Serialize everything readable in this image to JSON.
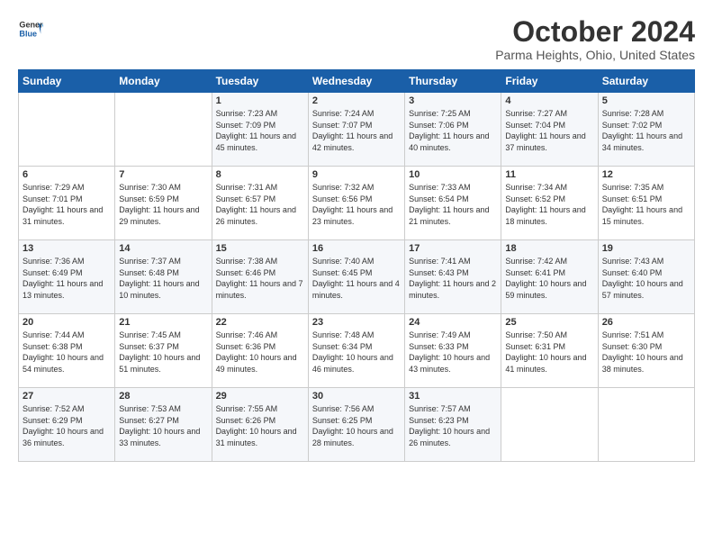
{
  "header": {
    "logo_line1": "General",
    "logo_line2": "Blue",
    "month": "October 2024",
    "location": "Parma Heights, Ohio, United States"
  },
  "days_of_week": [
    "Sunday",
    "Monday",
    "Tuesday",
    "Wednesday",
    "Thursday",
    "Friday",
    "Saturday"
  ],
  "weeks": [
    [
      {
        "day": "",
        "info": ""
      },
      {
        "day": "",
        "info": ""
      },
      {
        "day": "1",
        "info": "Sunrise: 7:23 AM\nSunset: 7:09 PM\nDaylight: 11 hours and 45 minutes."
      },
      {
        "day": "2",
        "info": "Sunrise: 7:24 AM\nSunset: 7:07 PM\nDaylight: 11 hours and 42 minutes."
      },
      {
        "day": "3",
        "info": "Sunrise: 7:25 AM\nSunset: 7:06 PM\nDaylight: 11 hours and 40 minutes."
      },
      {
        "day": "4",
        "info": "Sunrise: 7:27 AM\nSunset: 7:04 PM\nDaylight: 11 hours and 37 minutes."
      },
      {
        "day": "5",
        "info": "Sunrise: 7:28 AM\nSunset: 7:02 PM\nDaylight: 11 hours and 34 minutes."
      }
    ],
    [
      {
        "day": "6",
        "info": "Sunrise: 7:29 AM\nSunset: 7:01 PM\nDaylight: 11 hours and 31 minutes."
      },
      {
        "day": "7",
        "info": "Sunrise: 7:30 AM\nSunset: 6:59 PM\nDaylight: 11 hours and 29 minutes."
      },
      {
        "day": "8",
        "info": "Sunrise: 7:31 AM\nSunset: 6:57 PM\nDaylight: 11 hours and 26 minutes."
      },
      {
        "day": "9",
        "info": "Sunrise: 7:32 AM\nSunset: 6:56 PM\nDaylight: 11 hours and 23 minutes."
      },
      {
        "day": "10",
        "info": "Sunrise: 7:33 AM\nSunset: 6:54 PM\nDaylight: 11 hours and 21 minutes."
      },
      {
        "day": "11",
        "info": "Sunrise: 7:34 AM\nSunset: 6:52 PM\nDaylight: 11 hours and 18 minutes."
      },
      {
        "day": "12",
        "info": "Sunrise: 7:35 AM\nSunset: 6:51 PM\nDaylight: 11 hours and 15 minutes."
      }
    ],
    [
      {
        "day": "13",
        "info": "Sunrise: 7:36 AM\nSunset: 6:49 PM\nDaylight: 11 hours and 13 minutes."
      },
      {
        "day": "14",
        "info": "Sunrise: 7:37 AM\nSunset: 6:48 PM\nDaylight: 11 hours and 10 minutes."
      },
      {
        "day": "15",
        "info": "Sunrise: 7:38 AM\nSunset: 6:46 PM\nDaylight: 11 hours and 7 minutes."
      },
      {
        "day": "16",
        "info": "Sunrise: 7:40 AM\nSunset: 6:45 PM\nDaylight: 11 hours and 4 minutes."
      },
      {
        "day": "17",
        "info": "Sunrise: 7:41 AM\nSunset: 6:43 PM\nDaylight: 11 hours and 2 minutes."
      },
      {
        "day": "18",
        "info": "Sunrise: 7:42 AM\nSunset: 6:41 PM\nDaylight: 10 hours and 59 minutes."
      },
      {
        "day": "19",
        "info": "Sunrise: 7:43 AM\nSunset: 6:40 PM\nDaylight: 10 hours and 57 minutes."
      }
    ],
    [
      {
        "day": "20",
        "info": "Sunrise: 7:44 AM\nSunset: 6:38 PM\nDaylight: 10 hours and 54 minutes."
      },
      {
        "day": "21",
        "info": "Sunrise: 7:45 AM\nSunset: 6:37 PM\nDaylight: 10 hours and 51 minutes."
      },
      {
        "day": "22",
        "info": "Sunrise: 7:46 AM\nSunset: 6:36 PM\nDaylight: 10 hours and 49 minutes."
      },
      {
        "day": "23",
        "info": "Sunrise: 7:48 AM\nSunset: 6:34 PM\nDaylight: 10 hours and 46 minutes."
      },
      {
        "day": "24",
        "info": "Sunrise: 7:49 AM\nSunset: 6:33 PM\nDaylight: 10 hours and 43 minutes."
      },
      {
        "day": "25",
        "info": "Sunrise: 7:50 AM\nSunset: 6:31 PM\nDaylight: 10 hours and 41 minutes."
      },
      {
        "day": "26",
        "info": "Sunrise: 7:51 AM\nSunset: 6:30 PM\nDaylight: 10 hours and 38 minutes."
      }
    ],
    [
      {
        "day": "27",
        "info": "Sunrise: 7:52 AM\nSunset: 6:29 PM\nDaylight: 10 hours and 36 minutes."
      },
      {
        "day": "28",
        "info": "Sunrise: 7:53 AM\nSunset: 6:27 PM\nDaylight: 10 hours and 33 minutes."
      },
      {
        "day": "29",
        "info": "Sunrise: 7:55 AM\nSunset: 6:26 PM\nDaylight: 10 hours and 31 minutes."
      },
      {
        "day": "30",
        "info": "Sunrise: 7:56 AM\nSunset: 6:25 PM\nDaylight: 10 hours and 28 minutes."
      },
      {
        "day": "31",
        "info": "Sunrise: 7:57 AM\nSunset: 6:23 PM\nDaylight: 10 hours and 26 minutes."
      },
      {
        "day": "",
        "info": ""
      },
      {
        "day": "",
        "info": ""
      }
    ]
  ]
}
